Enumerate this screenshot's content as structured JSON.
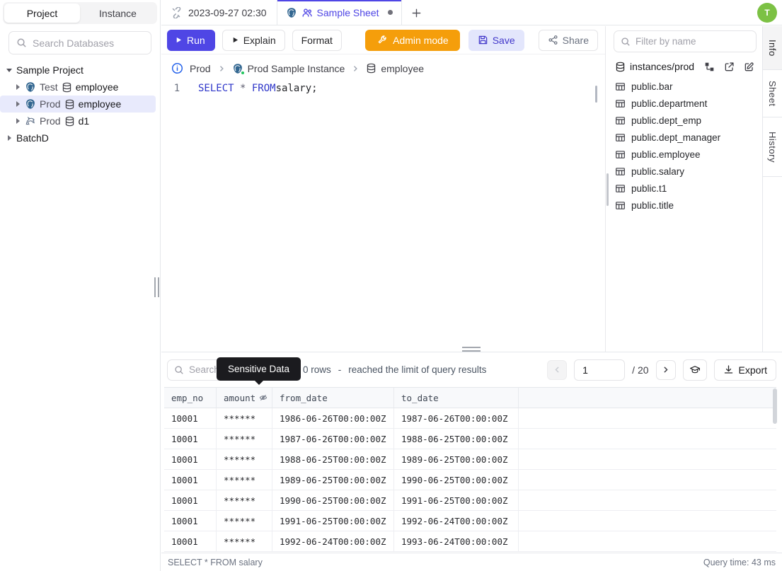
{
  "left_sidebar": {
    "tabs": [
      {
        "label": "Project"
      },
      {
        "label": "Instance"
      }
    ],
    "search_placeholder": "Search Databases",
    "tree": {
      "project1": "Sample Project",
      "items": [
        {
          "env": "Test",
          "db": "employee",
          "engine": "postgres"
        },
        {
          "env": "Prod",
          "db": "employee",
          "engine": "postgres"
        },
        {
          "env": "Prod",
          "db": "d1",
          "engine": "mysql"
        }
      ],
      "project2": "BatchD"
    }
  },
  "top_bar": {
    "history_tab_label": "2023-09-27 02:30",
    "sheet_tab_label": "Sample Sheet",
    "avatar_initial": "T"
  },
  "toolbar": {
    "run_label": "Run",
    "explain_label": "Explain",
    "format_label": "Format",
    "admin_mode_label": "Admin mode",
    "save_label": "Save",
    "share_label": "Share"
  },
  "breadcrumb": {
    "environment": "Prod",
    "instance": "Prod Sample Instance",
    "database": "employee"
  },
  "editor": {
    "line_number": "1",
    "sql": {
      "kw1": "SELECT",
      "op": " * ",
      "kw2": "FROM",
      "rest": "salary;"
    }
  },
  "right_panel": {
    "filter_placeholder": "Filter by name",
    "scope_label": "instances/prod",
    "tables": [
      "public.bar",
      "public.department",
      "public.dept_emp",
      "public.dept_manager",
      "public.employee",
      "public.salary",
      "public.t1",
      "public.title"
    ]
  },
  "side_tabs": [
    {
      "label": "Info"
    },
    {
      "label": "Sheet"
    },
    {
      "label": "History"
    }
  ],
  "results": {
    "search_placeholder": "Search",
    "tooltip_label": "Sensitive Data",
    "rows_count_text": "0 rows",
    "separator": "-",
    "limit_text": "reached the limit of query results",
    "page_value": "1",
    "page_total_text": "/ 20",
    "export_label": "Export",
    "columns": [
      "emp_no",
      "amount",
      "from_date",
      "to_date"
    ],
    "rows": [
      [
        "10001",
        "******",
        "1986-06-26T00:00:00Z",
        "1987-06-26T00:00:00Z"
      ],
      [
        "10001",
        "******",
        "1987-06-26T00:00:00Z",
        "1988-06-25T00:00:00Z"
      ],
      [
        "10001",
        "******",
        "1988-06-25T00:00:00Z",
        "1989-06-25T00:00:00Z"
      ],
      [
        "10001",
        "******",
        "1989-06-25T00:00:00Z",
        "1990-06-25T00:00:00Z"
      ],
      [
        "10001",
        "******",
        "1990-06-25T00:00:00Z",
        "1991-06-25T00:00:00Z"
      ],
      [
        "10001",
        "******",
        "1991-06-25T00:00:00Z",
        "1992-06-24T00:00:00Z"
      ],
      [
        "10001",
        "******",
        "1992-06-24T00:00:00Z",
        "1993-06-24T00:00:00Z"
      ]
    ],
    "status_query": "SELECT * FROM salary",
    "status_time": "Query time: 43 ms"
  },
  "icons": {
    "search": "magnifier",
    "history_tab": "unlink",
    "sheet_tab": "postgres-logo, people",
    "run": "play",
    "admin_mode": "wrench",
    "save": "floppy-disk",
    "share": "share-nodes",
    "breadcrumb_info": "info-circle",
    "database": "db-cylinder",
    "table": "table-grid",
    "amount_masked": "eye-off",
    "export": "download",
    "masking": "graduation-cap",
    "external": "external-link",
    "edit": "pencil-square",
    "schema": "schema-diagram",
    "new_tab": "plus",
    "pagination": "chevron-left, chevron-right"
  },
  "colors": {
    "accent": "#4f46e5",
    "admin_mode": "#f59e0b",
    "avatar": "#7cc144",
    "sql_keyword": "#2e36c9",
    "tooltip_bg": "#1b1b1f",
    "status_ok": "#22c55e"
  }
}
